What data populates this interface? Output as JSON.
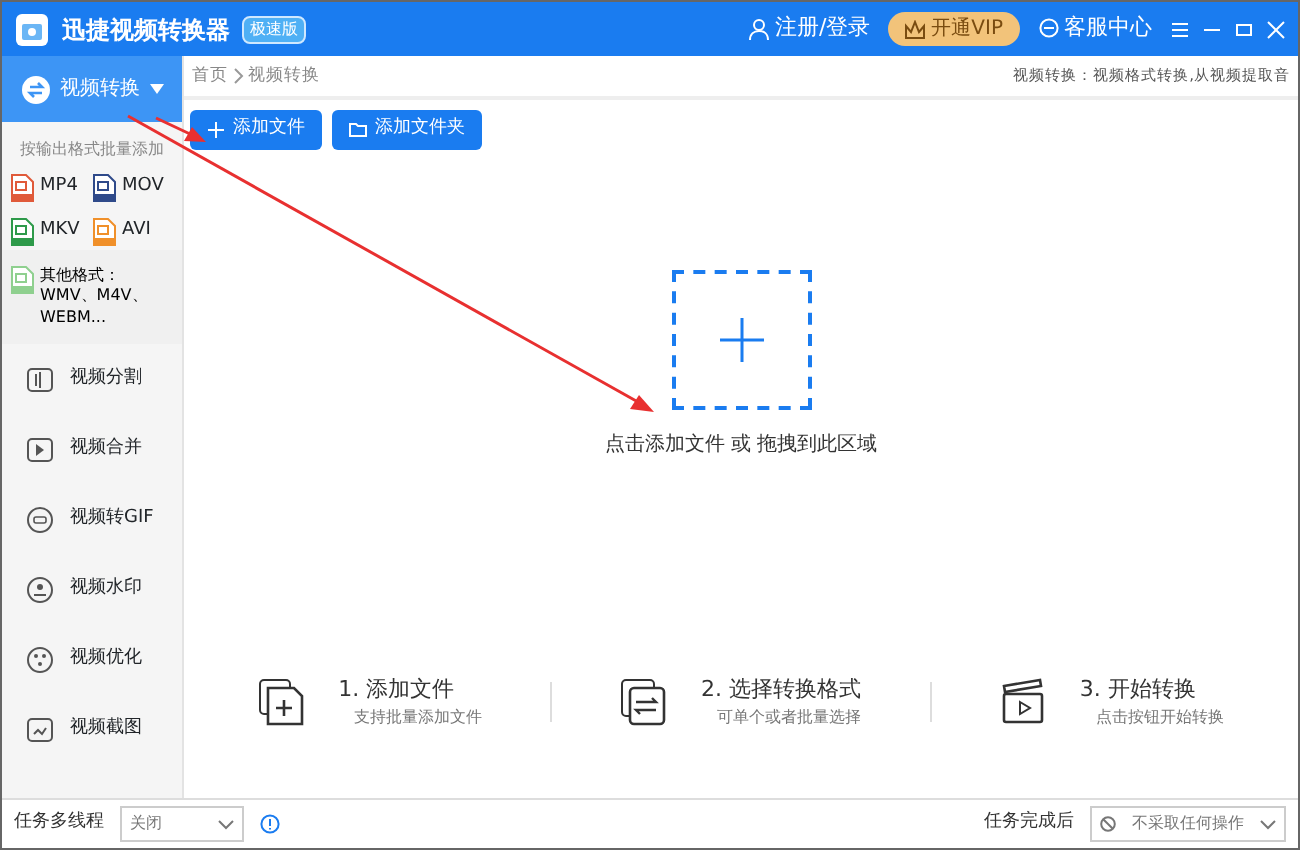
{
  "window": {
    "title": "迅捷视频转换器",
    "edition_badge": "极速版",
    "login": "注册/登录",
    "vip": "开通VIP",
    "support": "客服中心"
  },
  "sidebar": {
    "active_item": {
      "label": "视频转换",
      "expanded": true
    },
    "hint": "按输出格式批量添加",
    "formats": [
      {
        "label": "MP4",
        "color": "#e05a3a"
      },
      {
        "label": "MOV",
        "color": "#2f4a8a"
      },
      {
        "label": "MKV",
        "color": "#2e9a4a"
      },
      {
        "label": "AVI",
        "color": "#f0902a"
      }
    ],
    "other_formats": {
      "label": "其他格式：WMV、M4V、WEBM...",
      "color": "#8fd08f"
    },
    "items": [
      {
        "label": "视频分割",
        "kind": "split"
      },
      {
        "label": "视频合并",
        "kind": "merge"
      },
      {
        "label": "视频转GIF",
        "kind": "gif"
      },
      {
        "label": "视频水印",
        "kind": "watermark"
      },
      {
        "label": "视频优化",
        "kind": "optimize"
      },
      {
        "label": "视频截图",
        "kind": "screenshot"
      }
    ]
  },
  "breadcrumb": [
    "首页",
    "视频转换"
  ],
  "description": "视频转换：视频格式转换,从视频提取音",
  "buttons": [
    {
      "label": "添加文件",
      "kind": "plus"
    },
    {
      "label": "添加文件夹",
      "kind": "folder"
    }
  ],
  "drop_zone": {
    "text": "点击添加文件 或 拖拽到此区域"
  },
  "steps": [
    {
      "title": "1. 添加文件",
      "subtitle": "支持批量添加文件",
      "kind": "add"
    },
    {
      "title": "2. 选择转换格式",
      "subtitle": "可单个或者批量选择",
      "kind": "convert"
    },
    {
      "title": "3. 开始转换",
      "subtitle": "点击按钮开始转换",
      "kind": "start"
    }
  ],
  "status_bar": {
    "multithread_label": "任务多线程",
    "multithread_value": "关闭",
    "after_label": "任务完成后",
    "after_value": "不采取任何操作"
  }
}
